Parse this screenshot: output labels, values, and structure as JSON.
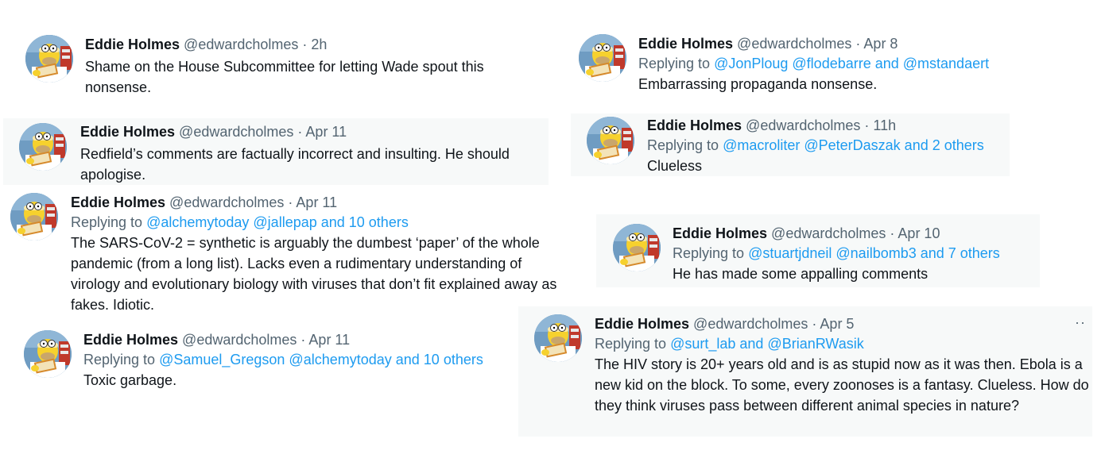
{
  "user": {
    "name": "Eddie Holmes",
    "handle": "@edwardcholmes"
  },
  "colors": {
    "link": "#1d9bf0",
    "muted": "#536471",
    "text": "#0f1419",
    "card_gray": "#f7f9f9"
  },
  "avatar_icon": "homer-reading-avatar",
  "tweets": [
    {
      "time": "2h",
      "text": "Shame on the House Subcommittee for letting Wade spout this nonsense."
    },
    {
      "time": "Apr 11",
      "text": "Redfield’s comments are factually incorrect and insulting. He should apologise."
    },
    {
      "time": "Apr 11",
      "reply_prefix": "Replying to",
      "reply_links": "@alchemytoday @jallepap and 10 others",
      "text": "The SARS-CoV-2 = synthetic is arguably the dumbest ‘paper’ of the whole pandemic (from a long list). Lacks even a rudimentary understanding of virology and evolutionary biology with viruses that don’t fit explained away as fakes. Idiotic."
    },
    {
      "time": "Apr 11",
      "reply_prefix": "Replying to",
      "reply_links": "@Samuel_Gregson @alchemytoday and 10 others",
      "text": "Toxic garbage."
    },
    {
      "time": "Apr 8",
      "reply_prefix": "Replying to",
      "reply_links": "@JonPloug @flodebarre and @mstandaert",
      "text": "Embarrassing propaganda nonsense."
    },
    {
      "time": "11h",
      "reply_prefix": "Replying to",
      "reply_links": "@macroliter @PeterDaszak and 2 others",
      "text": "Clueless"
    },
    {
      "time": "Apr 10",
      "reply_prefix": "Replying to",
      "reply_links": "@stuartjdneil @nailbomb3 and 7 others",
      "text": "He has made some appalling comments"
    },
    {
      "time": "Apr 5",
      "reply_prefix": "Replying to",
      "reply_links": "@surt_lab and @BrianRWasik",
      "text": "The HIV story is 20+ years old and is as stupid now as it was then. Ebola is a new kid on the block. To some, every zoonoses is a fantasy. Clueless. How do they think viruses pass between different animal species in nature?",
      "more_label": "··"
    }
  ]
}
